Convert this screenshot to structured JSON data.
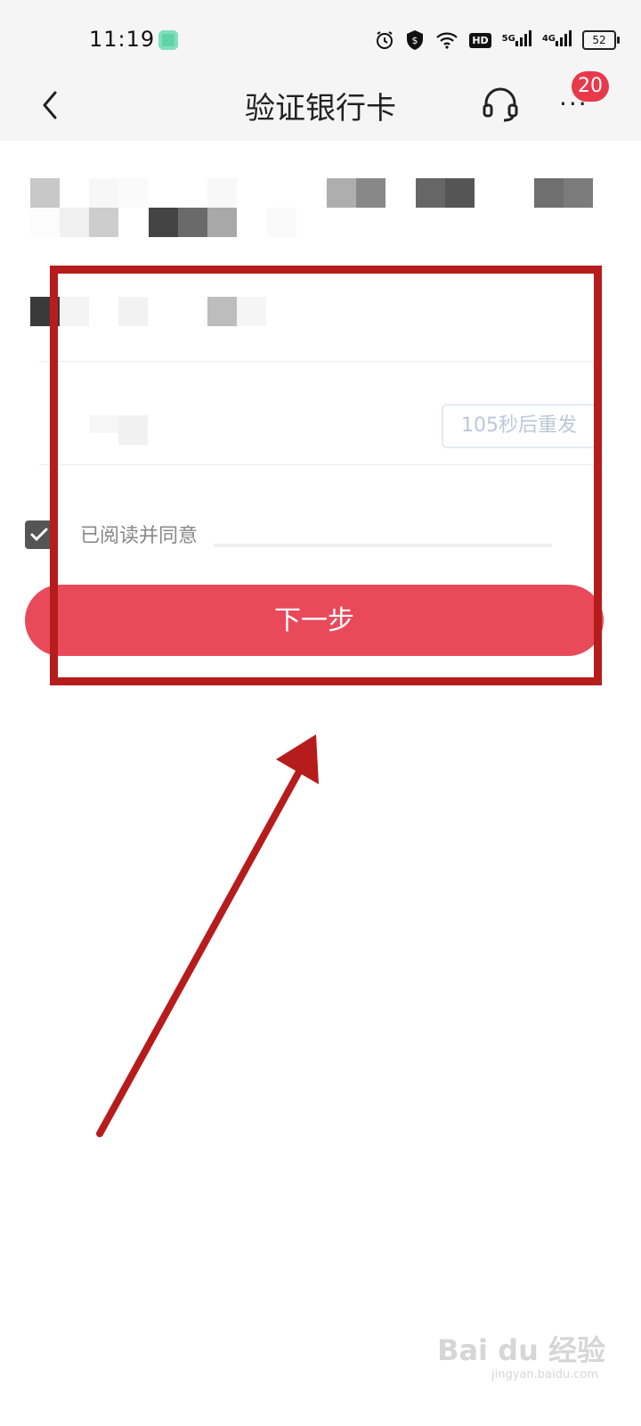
{
  "status_bar": {
    "time": "11:19",
    "hd_label": "HD",
    "net1": "5G",
    "net2": "4G",
    "battery": "52"
  },
  "nav": {
    "title": "验证银行卡",
    "badge_count": "20",
    "more_label": "···"
  },
  "form": {
    "resend_label": "105秒后重发",
    "agree_label": "已阅读并同意",
    "checkbox_checked": true,
    "next_button_label": "下一步"
  },
  "colors": {
    "primary_button": "#e84a5a",
    "badge": "#e8394a",
    "annotation": "#b71c1c"
  },
  "watermark": {
    "brand": "Bai du 经验",
    "url": "jingyan.baidu.com"
  }
}
